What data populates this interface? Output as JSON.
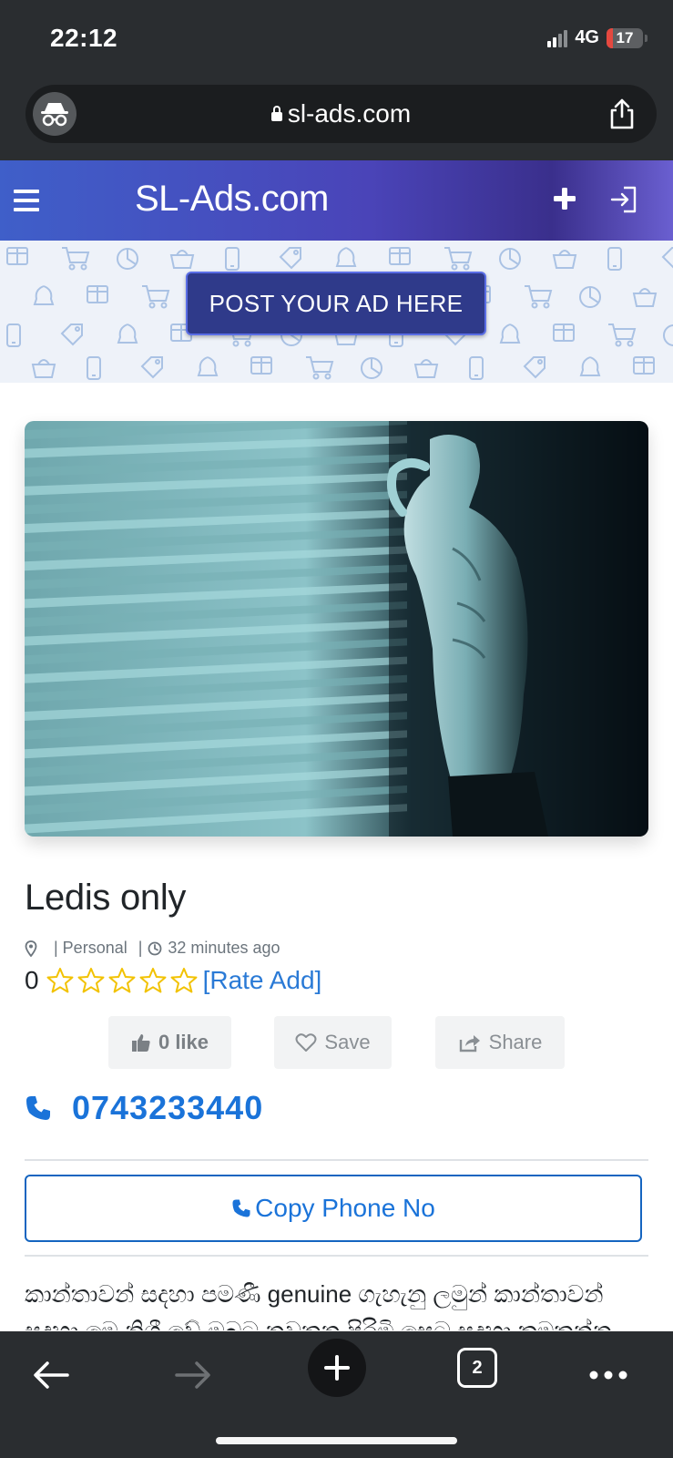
{
  "status_bar": {
    "time": "22:12",
    "network": "4G",
    "battery": "17",
    "battery_fraction": 0.17,
    "battery_color": "#e5483f"
  },
  "browser": {
    "url": "sl-ads.com",
    "incognito_icon": "incognito-icon",
    "share_icon": "share-icon"
  },
  "header": {
    "menu_icon": "hamburger-menu-icon",
    "title": "SL-Ads.com",
    "add_icon": "plus-icon",
    "login_icon": "login-icon",
    "gradient": [
      "#3f5fc9",
      "#4a44b8",
      "#3a2f8c",
      "#6a5fd0"
    ]
  },
  "banner": {
    "post_ad_label": "POST YOUR AD HERE",
    "button_color": "#2f3a8a"
  },
  "ad": {
    "image_icon": "ad-photo",
    "title": "Ledis only",
    "category": "| Personal",
    "category_separator": "|",
    "posted": "32 minutes ago",
    "rating_value": "0",
    "stars_filled": 0,
    "stars_total": 5,
    "rate_link": "[Rate Add]",
    "like_label": "0 like",
    "save_label": "Save",
    "share_label": "Share",
    "phone": "0743233440",
    "copy_label": "Copy Phone No",
    "description": "කාන්තාවන් සදහා පමණී genuine ගැහැනු ලමුන් කාන්තාවන් සදහා මෙ නිශී වේ ඔබට නවතන පිරිමි සෙට සදහා කමතන්න"
  },
  "colors": {
    "link_blue": "#1a73d9",
    "star_yellow": "#f2c200",
    "dark_chrome": "#2a2d30"
  },
  "toolbar": {
    "back_icon": "back-arrow-icon",
    "forward_icon": "forward-arrow-icon",
    "new_tab_icon": "plus-icon",
    "tab_count": "2",
    "more_icon": "more-dots-icon"
  }
}
